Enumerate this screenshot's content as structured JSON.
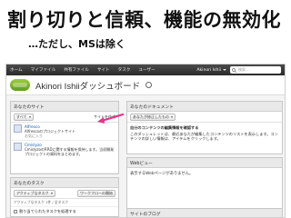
{
  "slide": {
    "title": "割り切りと信頼、機能の無効化",
    "subtitle": "…ただし、MSは除く"
  },
  "topnav": {
    "items": [
      "ホーム",
      "マイファイル",
      "共有ファイル",
      "サイト",
      "タスク",
      "ユーザー"
    ],
    "user_name": "Akinori Ishii",
    "search_placeholder": "検索..."
  },
  "header": {
    "title": "Akinori Ishiiダッシュボード"
  },
  "sites_panel": {
    "title": "あなたのサイト",
    "filter": "すべて",
    "create_button": "サイトを作成",
    "sites": [
      {
        "name": "Alfresco",
        "desc": "Alfrescoのプロジェクトサイト",
        "meta": "お気に入り"
      },
      {
        "name": "Cmislyzo",
        "desc": "CmislyzoのRRDに関する情報を保持します。当初開発プロジェクトの資料をまとめます。"
      }
    ]
  },
  "tasks_panel": {
    "title": "あなたのタスク",
    "filter": "アクティブなタスク",
    "workflow_button": "ワークフローの開始",
    "footer": "アクティブなタスク 1件 / 全タスク",
    "row": "割り当てられたタスクを処理する"
  },
  "documents_panel": {
    "title": "あなたのドキュメント",
    "filter": "あなたが修正したもの",
    "content_title": "自分のコンテンツの編集情報を確認する",
    "content_desc": "このダッシュレットは、最近あなたが編集したコンテンツのリストを表示します。コンテンツの詳しい情報は、アイテムをクリックします。"
  },
  "webview_panel": {
    "title": "Webビュー",
    "body": "表示するWebページがありません。"
  },
  "blog_panel": {
    "title": "サイトのブログ"
  }
}
